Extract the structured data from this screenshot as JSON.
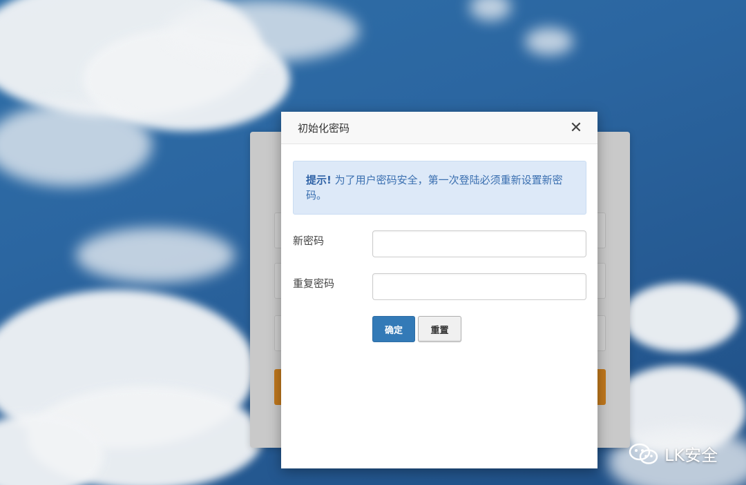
{
  "modal": {
    "title": "初始化密码",
    "close_symbol": "✕",
    "alert": {
      "strong": "提示!",
      "text": " 为了用户密码安全，第一次登陆必须重新设置新密码。"
    },
    "fields": [
      {
        "label": "新密码",
        "value": "",
        "placeholder": ""
      },
      {
        "label": "重复密码",
        "value": "",
        "placeholder": ""
      }
    ],
    "buttons": {
      "confirm": "确定",
      "reset": "重置"
    }
  },
  "watermark": {
    "text": "LK安全",
    "icon": "wechat-icon"
  },
  "colors": {
    "primary": "#337ab7",
    "alert_bg": "#dde9f8",
    "alert_text": "#3a6fb0",
    "background_orange": "#c0781d"
  }
}
